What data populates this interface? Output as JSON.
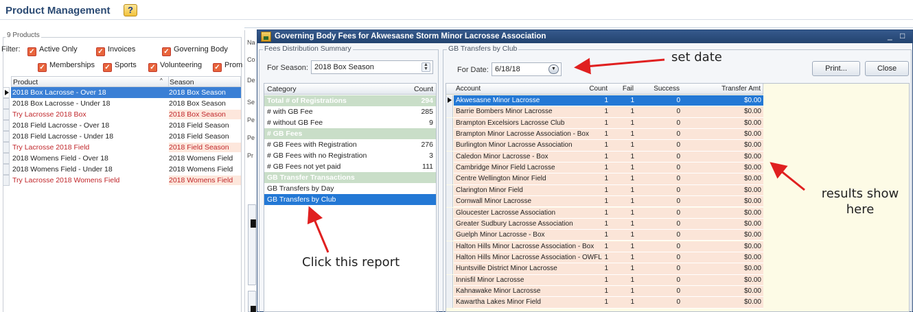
{
  "background": {
    "title": "Product Management",
    "products_count_label": "9 Products",
    "filter_label": "Filter:",
    "filters": [
      "Active Only",
      "Invoices",
      "Governing Body",
      "Memberships",
      "Sports",
      "Volunteering",
      "Prom"
    ],
    "columns": [
      "Product",
      "Season"
    ],
    "products": [
      {
        "name": "2018 Box Lacrosse - Over 18",
        "season": "2018 Box Season",
        "style": "selected"
      },
      {
        "name": "2018 Box Lacrosse - Under 18",
        "season": "2018 Box Season",
        "style": "normal"
      },
      {
        "name": "Try Lacrosse 2018 Box",
        "season": "2018 Box Season",
        "style": "red"
      },
      {
        "name": "2018 Field Lacrosse - Over 18",
        "season": "2018 Field Season",
        "style": "normal"
      },
      {
        "name": "2018 Field Lacrosse - Under 18",
        "season": "2018 Field Season",
        "style": "normal"
      },
      {
        "name": "Try Lacrosse 2018 Field",
        "season": "2018 Field Season",
        "style": "red"
      },
      {
        "name": "2018 Womens Field - Over 18",
        "season": "2018 Womens Field",
        "style": "normal"
      },
      {
        "name": "2018 Womens Field - Under 18",
        "season": "2018 Womens Field",
        "style": "normal"
      },
      {
        "name": "Try Lacrosse 2018 Womens Field",
        "season": "2018 Womens Field",
        "style": "red"
      }
    ],
    "side_letters": [
      "Na",
      "Co",
      "De",
      "Se",
      "Pe",
      "Pe",
      "Pr"
    ]
  },
  "modal": {
    "title": "Governing Body Fees for Akwesasne Storm Minor Lacrosse Association",
    "minimize": "_",
    "maximize": "□",
    "summary_group": "Fees Distribution Summary",
    "for_season_label": "For Season:",
    "season_value": "2018 Box Season",
    "transfers_group": "GB Transfers by Club",
    "for_date_label": "For Date:",
    "date_value": "6/18/18",
    "print_label": "Print...",
    "close_label": "Close",
    "category_columns": {
      "category": "Category",
      "count": "Count"
    },
    "categories": [
      {
        "label": "Total # of Registrations",
        "count": "294",
        "type": "section"
      },
      {
        "label": "# with GB Fee",
        "count": "285",
        "type": "item"
      },
      {
        "label": "# without GB Fee",
        "count": "9",
        "type": "item"
      },
      {
        "label": "# GB Fees",
        "count": "",
        "type": "section"
      },
      {
        "label": "# GB Fees with Registration",
        "count": "276",
        "type": "item"
      },
      {
        "label": "# GB Fees with no Registration",
        "count": "3",
        "type": "item"
      },
      {
        "label": "# GB Fees not yet paid",
        "count": "111",
        "type": "item"
      },
      {
        "label": "GB Transfer Transactions",
        "count": "",
        "type": "section"
      },
      {
        "label": "GB Transfers by Day",
        "count": "",
        "type": "item"
      },
      {
        "label": "GB Transfers by Club",
        "count": "",
        "type": "selected"
      }
    ],
    "account_columns": {
      "account": "Account",
      "count": "Count",
      "fail": "Fail",
      "success": "Success",
      "amount": "Transfer Amt"
    },
    "accounts": [
      {
        "account": "Akwesasne Minor Lacrosse",
        "count": "1",
        "fail": "1",
        "success": "0",
        "amount": "$0.00"
      },
      {
        "account": "Barrie Bombers Minor Lacrosse",
        "count": "1",
        "fail": "1",
        "success": "0",
        "amount": "$0.00"
      },
      {
        "account": "Brampton Excelsiors Lacrosse Club",
        "count": "1",
        "fail": "1",
        "success": "0",
        "amount": "$0.00"
      },
      {
        "account": "Brampton Minor Lacrosse Association - Box",
        "count": "1",
        "fail": "1",
        "success": "0",
        "amount": "$0.00"
      },
      {
        "account": "Burlington Minor Lacrosse Association",
        "count": "1",
        "fail": "1",
        "success": "0",
        "amount": "$0.00"
      },
      {
        "account": "Caledon Minor Lacrosse - Box",
        "count": "1",
        "fail": "1",
        "success": "0",
        "amount": "$0.00"
      },
      {
        "account": "Cambridge Minor Field Lacrosse",
        "count": "1",
        "fail": "1",
        "success": "0",
        "amount": "$0.00"
      },
      {
        "account": "Centre Wellington Minor Field",
        "count": "1",
        "fail": "1",
        "success": "0",
        "amount": "$0.00"
      },
      {
        "account": "Clarington Minor Field",
        "count": "1",
        "fail": "1",
        "success": "0",
        "amount": "$0.00"
      },
      {
        "account": "Cornwall Minor Lacrosse",
        "count": "1",
        "fail": "1",
        "success": "0",
        "amount": "$0.00"
      },
      {
        "account": "Gloucester Lacrosse Association",
        "count": "1",
        "fail": "1",
        "success": "0",
        "amount": "$0.00"
      },
      {
        "account": "Greater Sudbury Lacrosse Association",
        "count": "1",
        "fail": "1",
        "success": "0",
        "amount": "$0.00"
      },
      {
        "account": "Guelph Minor Lacrosse - Box",
        "count": "1",
        "fail": "1",
        "success": "0",
        "amount": "$0.00"
      },
      {
        "account": "Halton Hills Minor Lacrosse Association - Box",
        "count": "1",
        "fail": "1",
        "success": "0",
        "amount": "$0.00"
      },
      {
        "account": "Halton Hills Minor Lacrosse Association - OWFL",
        "count": "1",
        "fail": "1",
        "success": "0",
        "amount": "$0.00"
      },
      {
        "account": "Huntsville District Minor Lacrosse",
        "count": "1",
        "fail": "1",
        "success": "0",
        "amount": "$0.00"
      },
      {
        "account": "Innisfil Minor Lacrosse",
        "count": "1",
        "fail": "1",
        "success": "0",
        "amount": "$0.00"
      },
      {
        "account": "Kahnawake Minor Lacrosse",
        "count": "1",
        "fail": "1",
        "success": "0",
        "amount": "$0.00"
      },
      {
        "account": "Kawartha Lakes Minor Field",
        "count": "1",
        "fail": "1",
        "success": "0",
        "amount": "$0.00"
      }
    ]
  },
  "annotations": {
    "set_date": "set date",
    "click_report": "Click this report",
    "results_line1": "results show",
    "results_line2": "here"
  },
  "colors": {
    "selection": "#2378d5",
    "section_row": "#c9dec8",
    "account_row": "#fbe5d8",
    "annotation_arrow": "#e02020",
    "titlebar": "#2c4c7a"
  }
}
